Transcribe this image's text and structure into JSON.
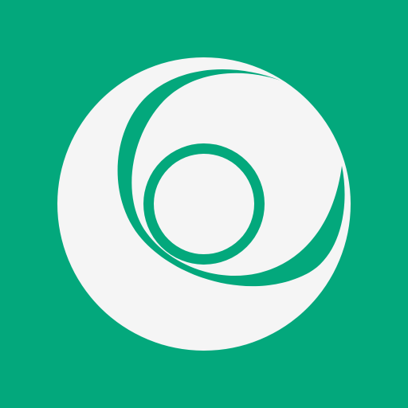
{
  "icon": {
    "name": "logo-mark",
    "colors": {
      "background": "#03A87C",
      "disc": "#F5F5F5",
      "ring": "#03A87C"
    }
  }
}
